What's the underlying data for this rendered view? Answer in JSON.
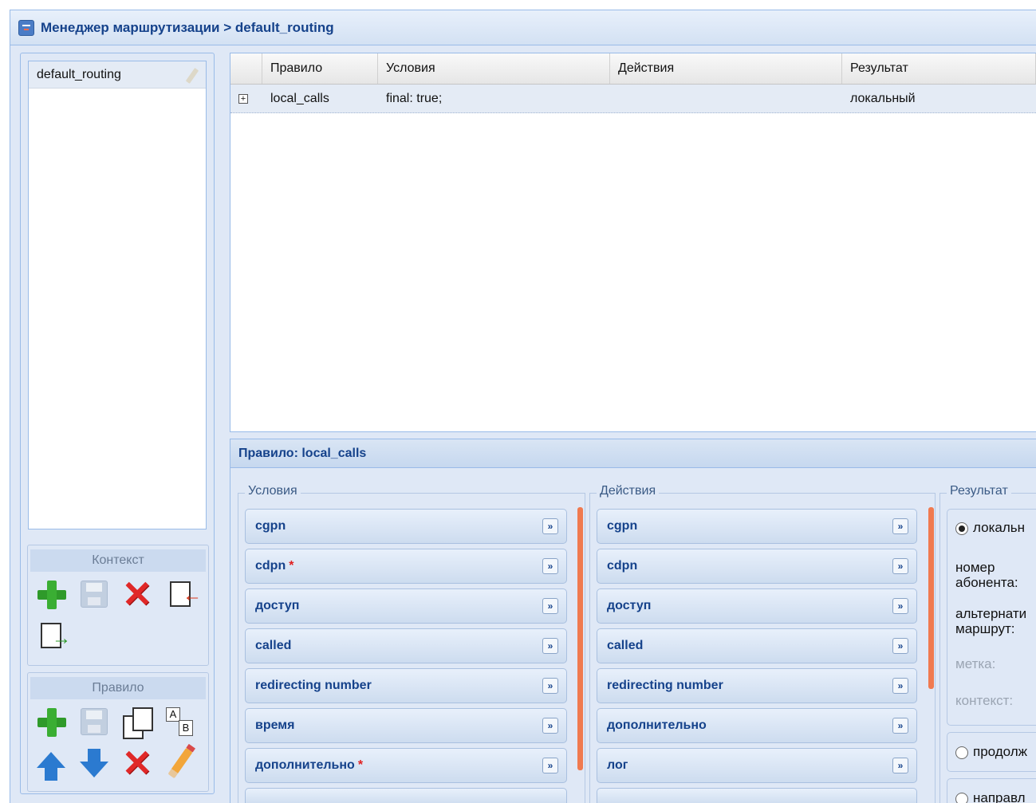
{
  "header": {
    "title": "Менеджер маршрутизации > default_routing"
  },
  "contexts": {
    "items": [
      "default_routing"
    ]
  },
  "toolbar_context": {
    "title": "Контекст"
  },
  "toolbar_rule": {
    "title": "Правило"
  },
  "grid": {
    "columns": [
      "",
      "Правило",
      "Условия",
      "Действия",
      "Результат"
    ],
    "rows": [
      {
        "rule": "local_calls",
        "conditions": "final: true;",
        "actions": "",
        "result": "локальный"
      }
    ]
  },
  "rule_panel": {
    "title": "Правило: local_calls",
    "conditions": {
      "legend": "Условия",
      "fields": [
        "cgpn",
        "cdpn",
        "доступ",
        "called",
        "redirecting number",
        "время",
        "дополнительно"
      ]
    },
    "actions": {
      "legend": "Действия",
      "fields": [
        "cgpn",
        "cdpn",
        "доступ",
        "called",
        "redirecting number",
        "дополнительно",
        "лог"
      ]
    },
    "result": {
      "legend": "Результат",
      "option_local": "локальн",
      "subscriber_label": "номер абонента:",
      "alt_route_label": "альтернати маршрут:",
      "tag_label": "метка:",
      "context_label": "контекст:",
      "option_continue": "продолж",
      "option_direct": "направл"
    }
  }
}
